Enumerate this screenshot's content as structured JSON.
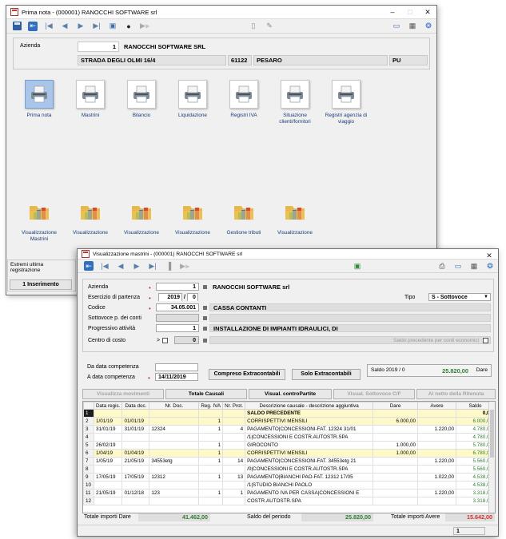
{
  "window1": {
    "title": "Prima nota  -  (000001) RANOCCHI SOFTWARE srl",
    "company": {
      "label": "Azienda",
      "code": "1",
      "name": "RANOCCHI SOFTWARE SRL",
      "address": "STRADA DEGLI OLMI 16/4",
      "cap": "61122",
      "city": "PESARO",
      "province": "PU"
    },
    "tiles_row1": [
      {
        "label": "Prima nota",
        "icon": "printer-icon"
      },
      {
        "label": "Mastrini",
        "icon": "printer-icon"
      },
      {
        "label": "Bilancio",
        "icon": "printer-icon"
      },
      {
        "label": "Liquidazione",
        "icon": "printer-icon"
      },
      {
        "label": "Registri IVA",
        "icon": "printer-icon"
      },
      {
        "label": "Situazione clienti/fornitori",
        "icon": "printer-icon"
      },
      {
        "label": "Registri agenzia di viaggio",
        "icon": "printer-icon"
      }
    ],
    "tiles_row2": [
      {
        "label": "Visualizzazione Mastrini",
        "icon": "folder-icon"
      },
      {
        "label": "Visualizzazione",
        "icon": "folder-icon"
      },
      {
        "label": "Visualizzazione",
        "icon": "folder-icon"
      },
      {
        "label": "Visualizzazione",
        "icon": "folder-icon"
      },
      {
        "label": "Gestione tributi",
        "icon": "folder-icon"
      },
      {
        "label": "Visualizzazione",
        "icon": "folder-icon"
      }
    ],
    "side": {
      "line1": "Estremi ultima",
      "line2": "registrazione",
      "button": "1 Inserimento"
    }
  },
  "window2": {
    "title": "Visualizzazione mastrini  -  (000001) RANOCCHI SOFTWARE srl",
    "form": {
      "azienda_label": "Azienda",
      "azienda_code": "1",
      "azienda_name": "RANOCCHI SOFTWARE srl",
      "esercizio_label": "Esercizio di partenza",
      "esercizio_year": "2019",
      "esercizio_sep": "/",
      "esercizio_num": "0",
      "tipo_label": "Tipo",
      "tipo_value": "S - Sottovoce",
      "codice_label": "Codice",
      "codice_value": "34.05.001",
      "codice_desc": "CASSA CONTANTI",
      "sottovoce_label": "Sottovoce p. dei conti",
      "progressivo_label": "Progressivo attività",
      "progressivo_value": "1",
      "progressivo_desc": "INSTALLAZIONE DI IMPIANTI IDRAULICI, DI",
      "centro_label": "Centro di costo",
      "centro_op": ">",
      "centro_value": "0",
      "saldo_prec_label": "Saldo precedente per conti economici"
    },
    "dates": {
      "da_label": "Da data competenza",
      "a_label": "A data competenza",
      "a_value": "14/11/2019",
      "btn_compreso": "Compreso Extracontabili",
      "btn_solo": "Solo Extracontabili",
      "saldo_label": "Saldo 2019 / 0",
      "saldo_value": "25.820,00",
      "saldo_side": "Dare"
    },
    "buttons": [
      {
        "label": "Visualizza movimenti",
        "enabled": false
      },
      {
        "label": "Totale Causali",
        "enabled": true
      },
      {
        "label": "Visual. controPartite",
        "enabled": true
      },
      {
        "label": "Visual. Sottovoce C/F",
        "enabled": false
      },
      {
        "label": "Al netto della Ritenuta",
        "enabled": false
      }
    ],
    "table": {
      "headers": [
        "",
        "Data regis.",
        "Data doc.",
        "Nr. Doc.",
        "Reg. IVA",
        "Nr. Prot.",
        "Descrizione causale - descrizione aggiuntiva",
        "Dare",
        "Avere",
        "Saldo"
      ],
      "rows": [
        [
          "1",
          "",
          "",
          "",
          "",
          "",
          "SALDO PRECEDENTE",
          "",
          "",
          "0,00"
        ],
        [
          "2",
          "1/01/19",
          "01/01/19",
          "",
          "1",
          "",
          "CORRISPETTIVI MENSILI",
          "6.000,00",
          "",
          "6.000,00"
        ],
        [
          "3",
          "31/01/19",
          "31/01/19",
          "12324",
          "1",
          "4",
          "PAGAMENTO|CONCESSIONI-FAT. 12324 31/01",
          "",
          "1.220,00",
          "4.780,00"
        ],
        [
          "4",
          "",
          "",
          "",
          "",
          "",
          "/1|CONCESSIONI E COSTR.AUTOSTR.SPA",
          "",
          "",
          "4.780,00"
        ],
        [
          "5",
          "26/02/19",
          "",
          "",
          "1",
          "",
          "GIROCONTO",
          "1.000,00",
          "",
          "5.780,00"
        ],
        [
          "6",
          "1/04/19",
          "01/04/19",
          "",
          "1",
          "",
          "CORRISPETTIVI MENSILI",
          "1.000,00",
          "",
          "6.780,00"
        ],
        [
          "7",
          "1/05/19",
          "21/05/19",
          "34553etg",
          "1",
          "14",
          "PAGAMENTO|CONCESSIONI-FAT. 34553etg 21",
          "",
          "1.220,00",
          "5.560,00"
        ],
        [
          "8",
          "",
          "",
          "",
          "",
          "",
          "/0|CONCESSIONI E COSTR.AUTOSTR.SPA",
          "",
          "",
          "5.560,00"
        ],
        [
          "9",
          "17/05/19",
          "17/05/19",
          "12312",
          "1",
          "13",
          "PAGAMENTO|BIANCHI PAO-FAT. 12312 17/05",
          "",
          "1.022,00",
          "4.538,00"
        ],
        [
          "10",
          "",
          "",
          "",
          "",
          "",
          "/1|STUDIO BIANCHI PAOLO",
          "",
          "",
          "4.538,00"
        ],
        [
          "11",
          "21/05/19",
          "01/12/18",
          "123",
          "1",
          "1",
          "PAGAMENTO IVA PER CASSA|CONCESSIONI E",
          "",
          "1.220,00",
          "3.318,00"
        ],
        [
          "12",
          "",
          "",
          "",
          "",
          "",
          "COSTR.AUTOSTR.SPA",
          "",
          "",
          "3.318,00"
        ]
      ]
    },
    "totals": {
      "dare_label": "Totale importi Dare",
      "dare_value": "41.462,00",
      "periodo_label": "Saldo del periodo",
      "periodo_value": "25.820,00",
      "avere_label": "Totale importi Avere",
      "avere_value": "15.642,00"
    },
    "status_page": "1"
  },
  "colors": {
    "accent_blue": "#2f6fc0",
    "yellow_row": "#fdf9c9",
    "green_value": "#2e7d32",
    "red_value": "#d32f2f",
    "required_dot": "#c0392b"
  }
}
